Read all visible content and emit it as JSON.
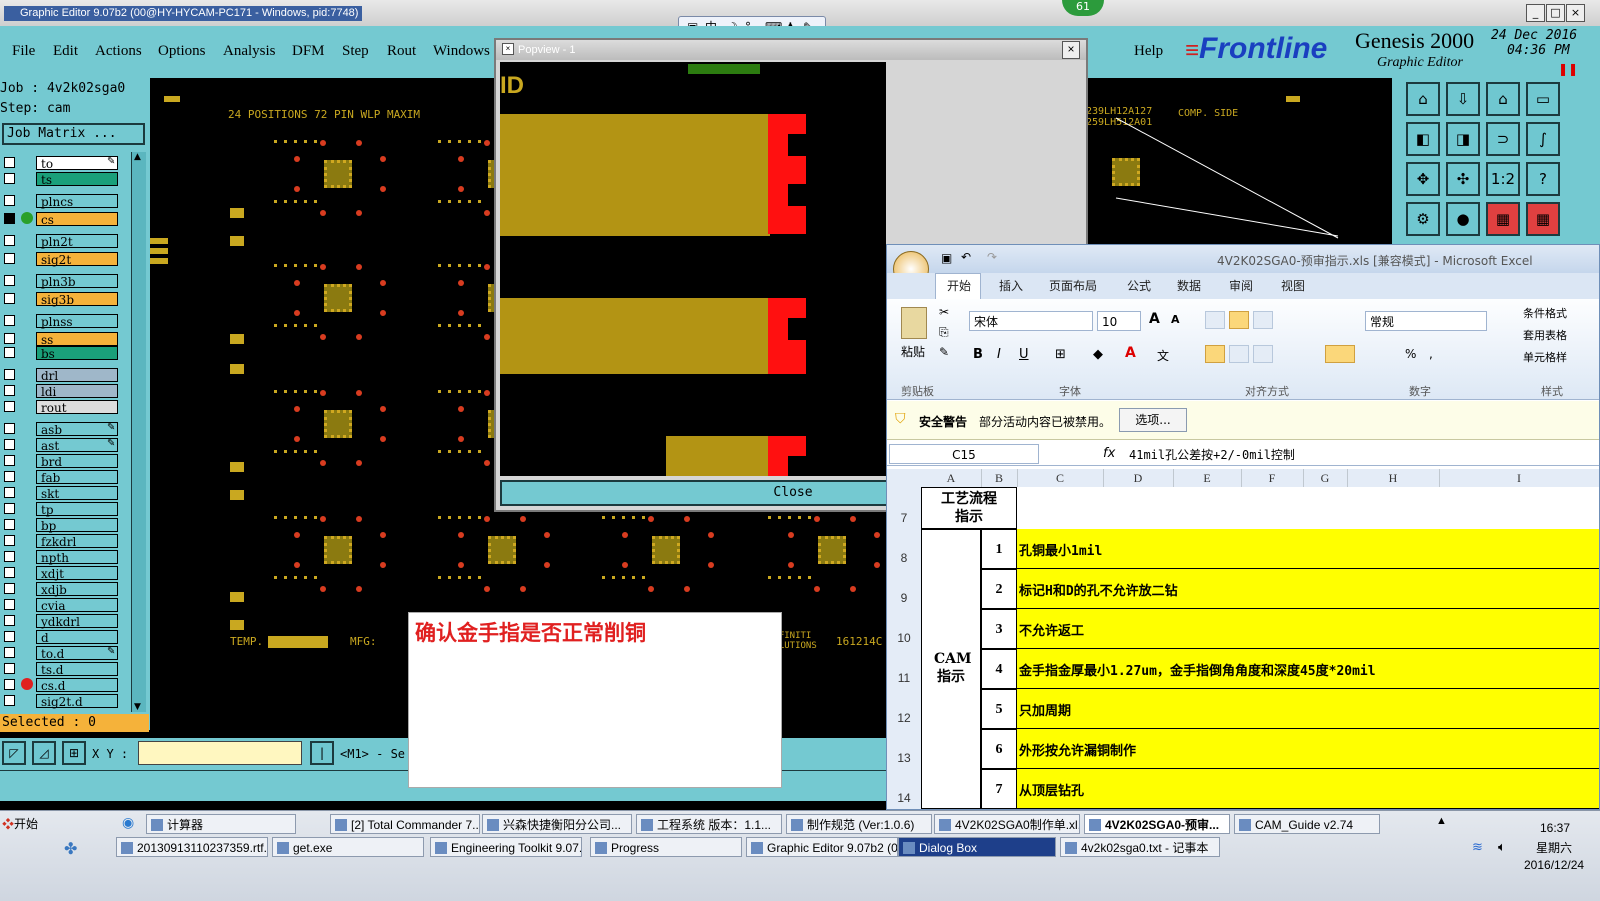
{
  "app": {
    "title": "Graphic Editor 9.07b2 (00@HY-HYCAM-PC171 - Windows, pid:7748)",
    "badge_number": "61",
    "window_controls": [
      "_",
      "□",
      "×"
    ]
  },
  "menu": [
    "File",
    "Edit",
    "Actions",
    "Options",
    "Analysis",
    "DFM",
    "Step",
    "Rout",
    "Windows"
  ],
  "help_label": "Help",
  "brand": {
    "logo": "Frontline",
    "product": "Genesis 2000",
    "subtitle": "Graphic Editor",
    "date": "24 Dec 2016",
    "time": "04:36 PM"
  },
  "job_panel": {
    "job_label": "Job : 4v2k02sga0",
    "step_label": "Step: cam",
    "matrix_button": "Job Matrix ...",
    "selected": "Selected : 0",
    "layers": [
      {
        "name": "to",
        "color": "#ffffff",
        "mark": true
      },
      {
        "name": "ts",
        "color": "#1aa07a",
        "mark": false
      },
      {
        "name": "plncs",
        "color": "#74c9d1",
        "mark": false
      },
      {
        "name": "cs",
        "color": "#f5b23a",
        "mark": false,
        "active": true,
        "dot": "#2aa02a"
      },
      {
        "name": "pln2t",
        "color": "#74c9d1",
        "mark": false
      },
      {
        "name": "sig2t",
        "color": "#f5b23a",
        "mark": false
      },
      {
        "name": "pln3b",
        "color": "#74c9d1",
        "mark": false
      },
      {
        "name": "sig3b",
        "color": "#f5b23a",
        "mark": false
      },
      {
        "name": "plnss",
        "color": "#74c9d1",
        "mark": false
      },
      {
        "name": "ss",
        "color": "#f5b23a",
        "mark": false
      },
      {
        "name": "bs",
        "color": "#1aa07a",
        "mark": false
      },
      {
        "name": "drl",
        "color": "#9fb7c9",
        "mark": false
      },
      {
        "name": "ldi",
        "color": "#9fb7c9",
        "mark": false
      },
      {
        "name": "rout",
        "color": "#dddddd",
        "mark": false
      },
      {
        "name": "asb",
        "color": "#74c9d1",
        "mark": true
      },
      {
        "name": "ast",
        "color": "#74c9d1",
        "mark": true
      },
      {
        "name": "brd",
        "color": "#74c9d1",
        "mark": false
      },
      {
        "name": "fab",
        "color": "#74c9d1",
        "mark": false
      },
      {
        "name": "skt",
        "color": "#74c9d1",
        "mark": false
      },
      {
        "name": "tp",
        "color": "#74c9d1",
        "mark": false
      },
      {
        "name": "bp",
        "color": "#74c9d1",
        "mark": false
      },
      {
        "name": "fzkdrl",
        "color": "#74c9d1",
        "mark": false
      },
      {
        "name": "npth",
        "color": "#74c9d1",
        "mark": false
      },
      {
        "name": "xdjt",
        "color": "#74c9d1",
        "mark": false
      },
      {
        "name": "xdjb",
        "color": "#74c9d1",
        "mark": false
      },
      {
        "name": "cvia",
        "color": "#74c9d1",
        "mark": false
      },
      {
        "name": "ydkdrl",
        "color": "#74c9d1",
        "mark": false
      },
      {
        "name": "d",
        "color": "#74c9d1",
        "mark": false
      },
      {
        "name": "to.d",
        "color": "#74c9d1",
        "mark": true
      },
      {
        "name": "ts.d",
        "color": "#74c9d1",
        "mark": false
      },
      {
        "name": "cs.d",
        "color": "#74c9d1",
        "mark": false,
        "dot": "#e02020"
      },
      {
        "name": "sig2t.d",
        "color": "#74c9d1",
        "mark": false
      }
    ]
  },
  "graphic_text": {
    "header": "24 POSITIONS  72 PIN WLP   MAXIM",
    "comp_side": "COMP. SIDE",
    "part1": "239LH12A127",
    "part2": "259LH512A01",
    "temp": "TEMP.",
    "mfg": "MFG:",
    "infiniti": "INFINITI SOLUTIONS",
    "num": "161214C"
  },
  "coord_bar": {
    "xy_label": "X Y :",
    "xy_value": "",
    "mode": "<M1> - Se"
  },
  "popview": {
    "title": "Popview - 1",
    "id_text": "ID",
    "close": "Close"
  },
  "note": {
    "text": "确认金手指是否正常削铜"
  },
  "excel": {
    "title": "4V2K02SGA0-预审指示.xls  [兼容模式] - Microsoft Excel",
    "tabs": [
      "开始",
      "插入",
      "页面布局",
      "公式",
      "数据",
      "审阅",
      "视图"
    ],
    "font_name": "宋体",
    "font_size": "10",
    "number_format": "常规",
    "paste": "粘贴",
    "groups": [
      "剪贴板",
      "字体",
      "对齐方式",
      "数字",
      "样式"
    ],
    "styles": [
      "条件格式",
      "套用表格",
      "单元格样"
    ],
    "security_label": "安全警告",
    "security_msg": "部分活动内容已被禁用。",
    "options_btn": "选项...",
    "cell_ref": "C15",
    "formula": "41mil孔公差按+2/-0mil控制",
    "columns": [
      "A",
      "B",
      "C",
      "D",
      "E",
      "F",
      "G",
      "H",
      "I"
    ],
    "header_cell": "工艺流程指示",
    "section": "CAM指示",
    "rows": [
      {
        "row": "7",
        "num": "",
        "text": ""
      },
      {
        "row": "8",
        "num": "1",
        "text": "孔铜最小1mil"
      },
      {
        "row": "9",
        "num": "2",
        "text": "标记H和D的孔不允许放二钻"
      },
      {
        "row": "10",
        "num": "3",
        "text": "不允许返工"
      },
      {
        "row": "11",
        "num": "4",
        "text": "金手指金厚最小1.27um，金手指倒角角度和深度45度*20mil"
      },
      {
        "row": "12",
        "num": "5",
        "text": "只加周期"
      },
      {
        "row": "13",
        "num": "6",
        "text": "外形按允许漏铜制作"
      },
      {
        "row": "14",
        "num": "7",
        "text": "从顶层钻孔"
      }
    ]
  },
  "taskbar": {
    "start": "开始",
    "row1": [
      "计算器",
      "[2] Total Commander 7...",
      "兴森快捷衡阳分公司...",
      "工程系统  版本：1.1...",
      "制作规范 (Ver:1.0.6)",
      "4V2K02SGA0制作单.xl...",
      "4V2K02SGA0-预审...",
      "CAM_Guide v2.74"
    ],
    "row2": [
      "20130913110237359.rtf...",
      "get.exe",
      "Engineering Toolkit 9.07...",
      "Progress",
      "Graphic Editor 9.07b2 (0...",
      "Dialog Box",
      "4v2k02sga0.txt - 记事本"
    ],
    "clock_time": "16:37",
    "clock_day": "星期六",
    "clock_date": "2016/12/24"
  },
  "ime_bar": "中"
}
